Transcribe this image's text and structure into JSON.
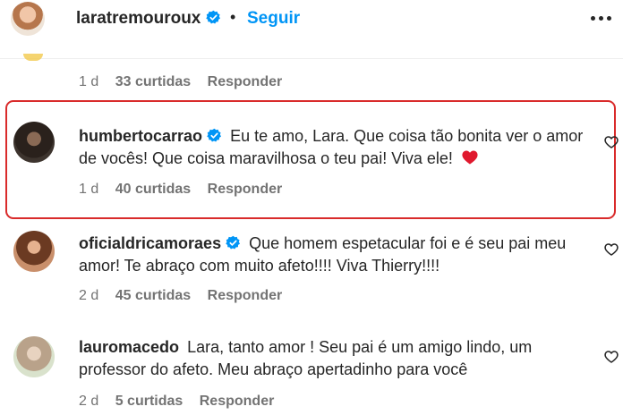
{
  "header": {
    "username": "laratremouroux",
    "separator": "•",
    "follow_label": "Seguir"
  },
  "top_comment": {
    "age": "1 d",
    "likes": "33 curtidas",
    "reply": "Responder"
  },
  "comments": [
    {
      "username": "humbertocarrao",
      "verified": true,
      "text": "Eu te amo, Lara. Que coisa tão bonita ver o amor de vocês! Que coisa maravilhosa o teu pai! Viva ele!",
      "emoji": "heart-emoji",
      "age": "1 d",
      "likes": "40 curtidas",
      "reply": "Responder",
      "highlighted": true
    },
    {
      "username": "oficialdricamoraes",
      "verified": true,
      "text": "Que homem espetacular foi e é seu pai meu amor! Te abraço com muito afeto!!!! Viva Thierry!!!!",
      "age": "2 d",
      "likes": "45 curtidas",
      "reply": "Responder"
    },
    {
      "username": "lauromacedo",
      "verified": false,
      "text": "Lara, tanto amor ! Seu pai é um amigo lindo, um professor do afeto. Meu abraço apertadinho para você",
      "age": "2 d",
      "likes": "5 curtidas",
      "reply": "Responder"
    }
  ],
  "colors": {
    "link": "#0095f6",
    "verified": "#0095f6",
    "highlight_border": "#d92b2b",
    "secondary_text": "#737373"
  },
  "icons": [
    "verified-badge-icon",
    "more-options-icon",
    "heart-outline-icon",
    "heart-emoji"
  ]
}
